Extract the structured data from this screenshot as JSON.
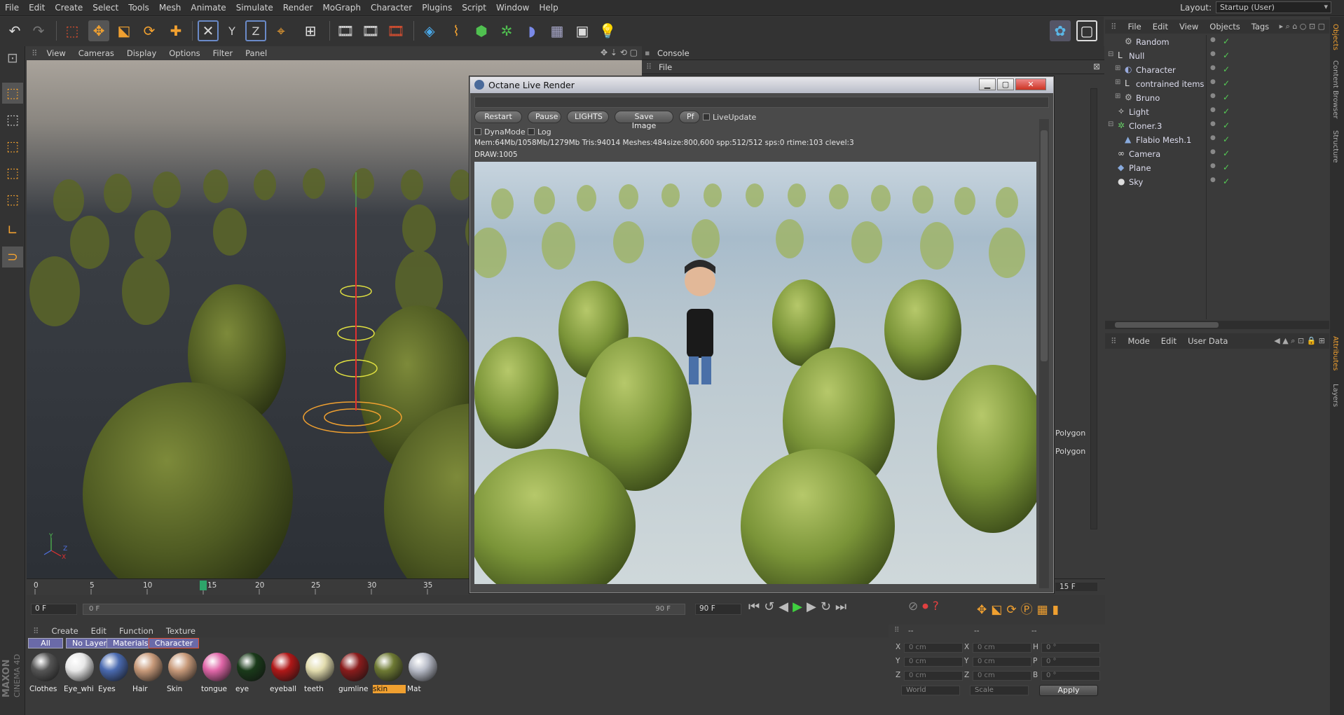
{
  "menubar": {
    "items": [
      "File",
      "Edit",
      "Create",
      "Select",
      "Tools",
      "Mesh",
      "Animate",
      "Simulate",
      "Render",
      "MoGraph",
      "Character",
      "Plugins",
      "Script",
      "Window",
      "Help"
    ],
    "layout_label": "Layout:",
    "layout_value": "Startup (User)"
  },
  "viewport": {
    "menu": [
      "View",
      "Cameras",
      "Display",
      "Options",
      "Filter",
      "Panel"
    ],
    "axis_x": "X",
    "axis_y": "Y",
    "axis_z": "Z"
  },
  "console": {
    "title": "Console",
    "file_menu": "File",
    "polygon1": "Polygon",
    "polygon2": "Polygon"
  },
  "octane": {
    "title": "Octane Live Render",
    "buttons": [
      "Restart",
      "Pause",
      "LIGHTS",
      "Save Image",
      "Pf"
    ],
    "liveupdate": "LiveUpdate",
    "dynamode": "DynaMode",
    "log": "Log",
    "status1": "Mem:64Mb/1058Mb/1279Mb Tris:94014 Meshes:484size:800,600 spp:512/512 sps:0 rtime:103 clevel:3",
    "status2": "DRAW:1005"
  },
  "objects": {
    "menu": [
      "File",
      "Edit",
      "View",
      "Objects",
      "Tags"
    ],
    "items": [
      {
        "name": "Random",
        "indent": 1
      },
      {
        "name": "Null",
        "indent": 0
      },
      {
        "name": "Character",
        "indent": 1
      },
      {
        "name": "contrained items",
        "indent": 1
      },
      {
        "name": "Bruno",
        "indent": 1
      },
      {
        "name": "Light",
        "indent": 0
      },
      {
        "name": "Cloner.3",
        "indent": 0
      },
      {
        "name": "Flabio Mesh.1",
        "indent": 1
      },
      {
        "name": "Camera",
        "indent": 0
      },
      {
        "name": "Plane",
        "indent": 0
      },
      {
        "name": "Sky",
        "indent": 0
      }
    ]
  },
  "attributes": {
    "menu": [
      "Mode",
      "Edit",
      "User Data"
    ]
  },
  "side_tabs": [
    "Objects",
    "Content Browser",
    "Structure",
    "Attributes",
    "Layers"
  ],
  "timeline": {
    "ticks": [
      "0",
      "5",
      "10",
      "15",
      "20",
      "25",
      "30",
      "35"
    ],
    "current_frame": 15,
    "end_label": "15 F",
    "start_field": "0 F",
    "range_start": "0 F",
    "range_end": "90 F",
    "max_field": "90 F"
  },
  "materials": {
    "menu": [
      "Create",
      "Edit",
      "Function",
      "Texture"
    ],
    "tabs": [
      "All",
      "No Layer",
      "Materials",
      "Character"
    ],
    "items": [
      {
        "label": "Clothes",
        "color": "#555"
      },
      {
        "label": "Eye_whi",
        "color": "#e8e8e8"
      },
      {
        "label": "Eyes",
        "color": "#4a6ab0"
      },
      {
        "label": "Hair",
        "color": "#c89a7a"
      },
      {
        "label": "Skin",
        "color": "#c89a7a"
      },
      {
        "label": "tongue",
        "color": "#e066a8"
      },
      {
        "label": "eye",
        "color": "#1a3a1a"
      },
      {
        "label": "eyeball",
        "color": "#b01818"
      },
      {
        "label": "teeth",
        "color": "#e2dcae"
      },
      {
        "label": "gumline",
        "color": "#8a1c1c"
      },
      {
        "label": "skin",
        "color": "#6e7a34",
        "selected": true
      },
      {
        "label": "Mat",
        "color": "#b8bcc8"
      }
    ]
  },
  "coords": {
    "col_head1": "--",
    "col_head2": "--",
    "col_head3": "--",
    "rows": [
      {
        "l1": "X",
        "v1": "0 cm",
        "l2": "X",
        "v2": "0 cm",
        "l3": "H",
        "v3": "0 °"
      },
      {
        "l1": "Y",
        "v1": "0 cm",
        "l2": "Y",
        "v2": "0 cm",
        "l3": "P",
        "v3": "0 °"
      },
      {
        "l1": "Z",
        "v1": "0 cm",
        "l2": "Z",
        "v2": "0 cm",
        "l3": "B",
        "v3": "0 °"
      }
    ],
    "world": "World",
    "scale": "Scale",
    "apply": "Apply"
  },
  "branding": {
    "line1": "MAXON",
    "line2": "CINEMA 4D"
  },
  "colors": {
    "accent": "#f0a030",
    "octane_title": "#c8ccd6",
    "material_tab": "#6a6aa8"
  }
}
